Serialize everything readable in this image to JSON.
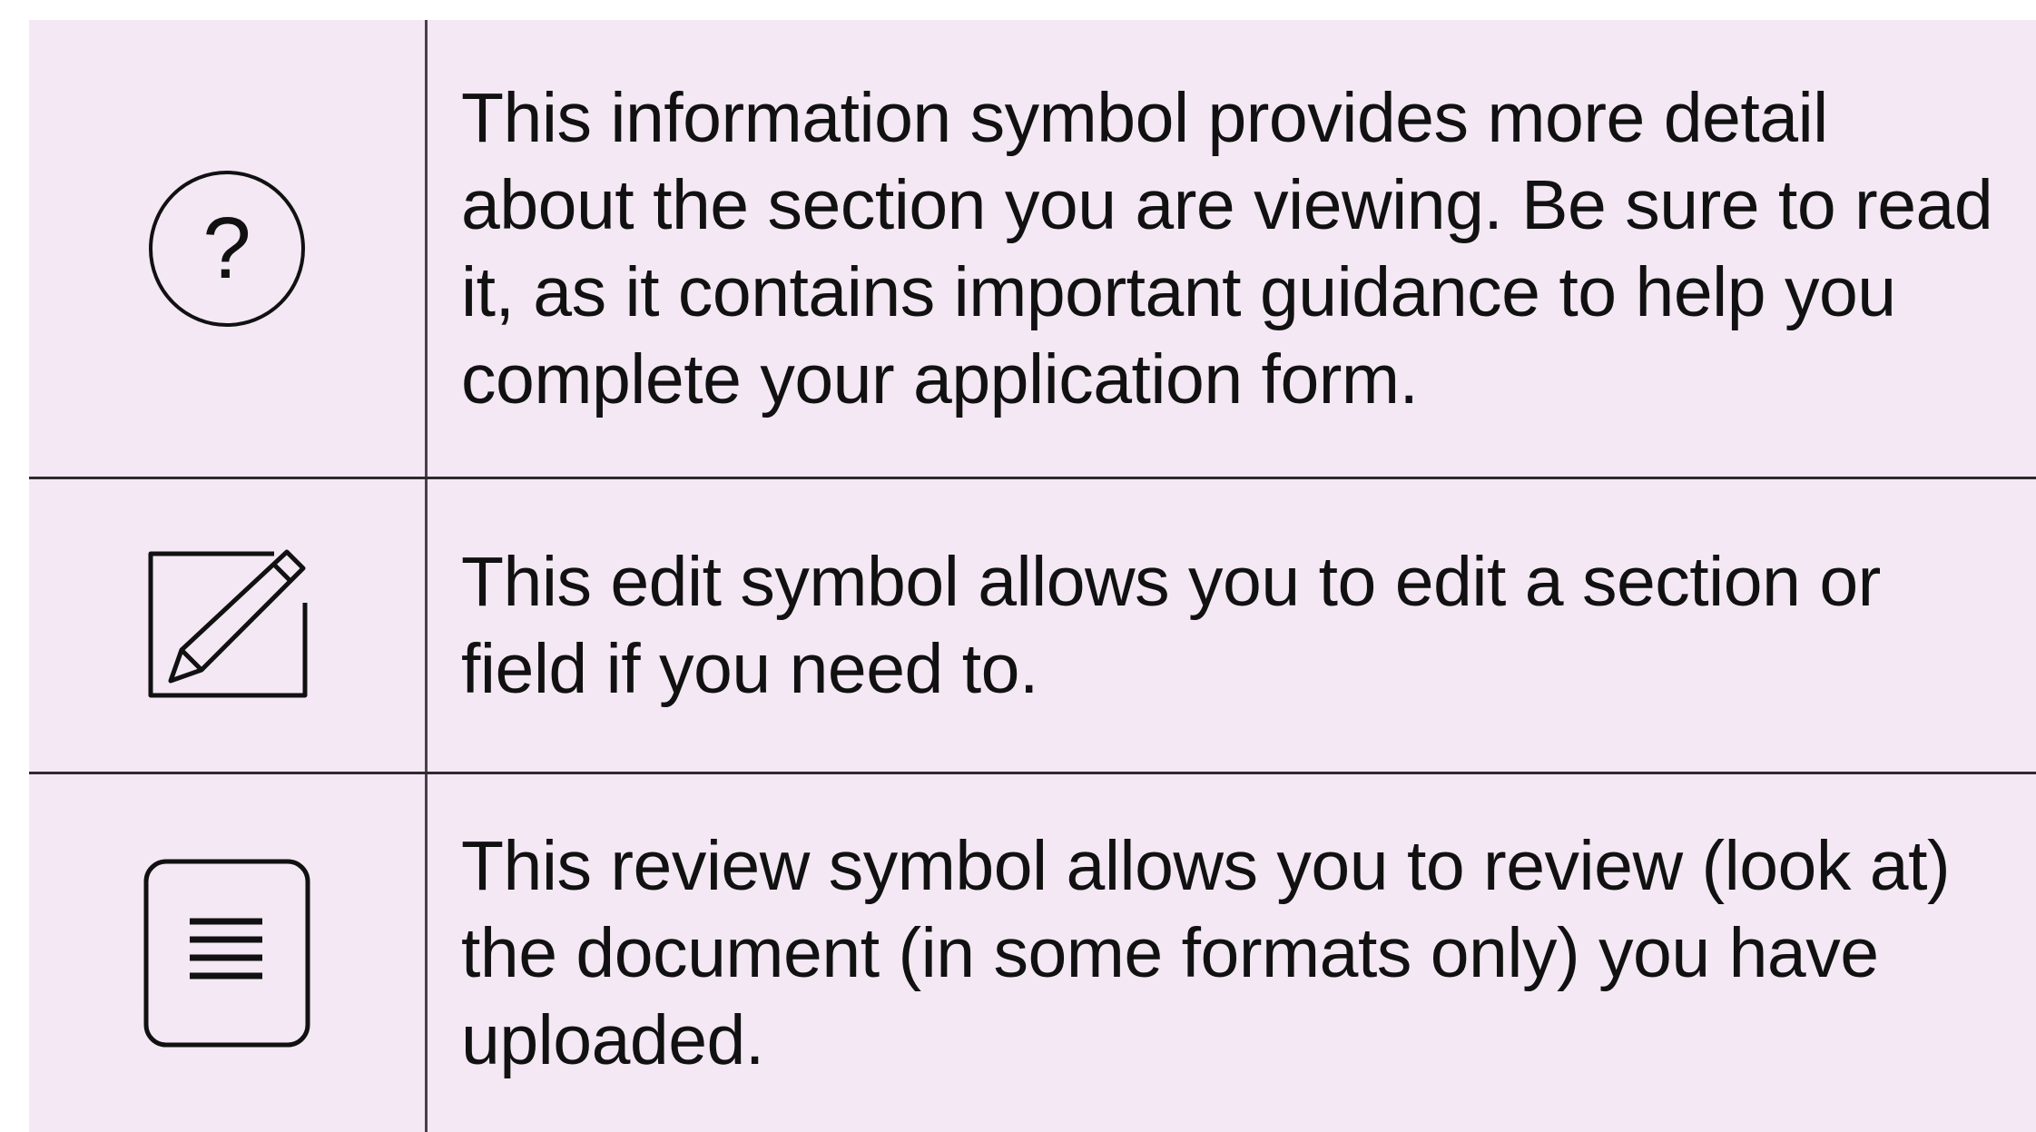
{
  "rows": [
    {
      "icon": "help-question-icon",
      "text": "This information symbol provides more detail about the section you are viewing. Be sure to read it, as it contains important guidance to help you complete your application form."
    },
    {
      "icon": "edit-pencil-icon",
      "text": "This edit symbol allows you to edit a section or field if you need to."
    },
    {
      "icon": "review-document-icon",
      "text": "This review symbol allows you to review (look at) the document (in some formats only) you have uploaded."
    }
  ],
  "colors": {
    "background": "#f3e8f3",
    "border": "#2e2a2e",
    "text": "#111111"
  }
}
